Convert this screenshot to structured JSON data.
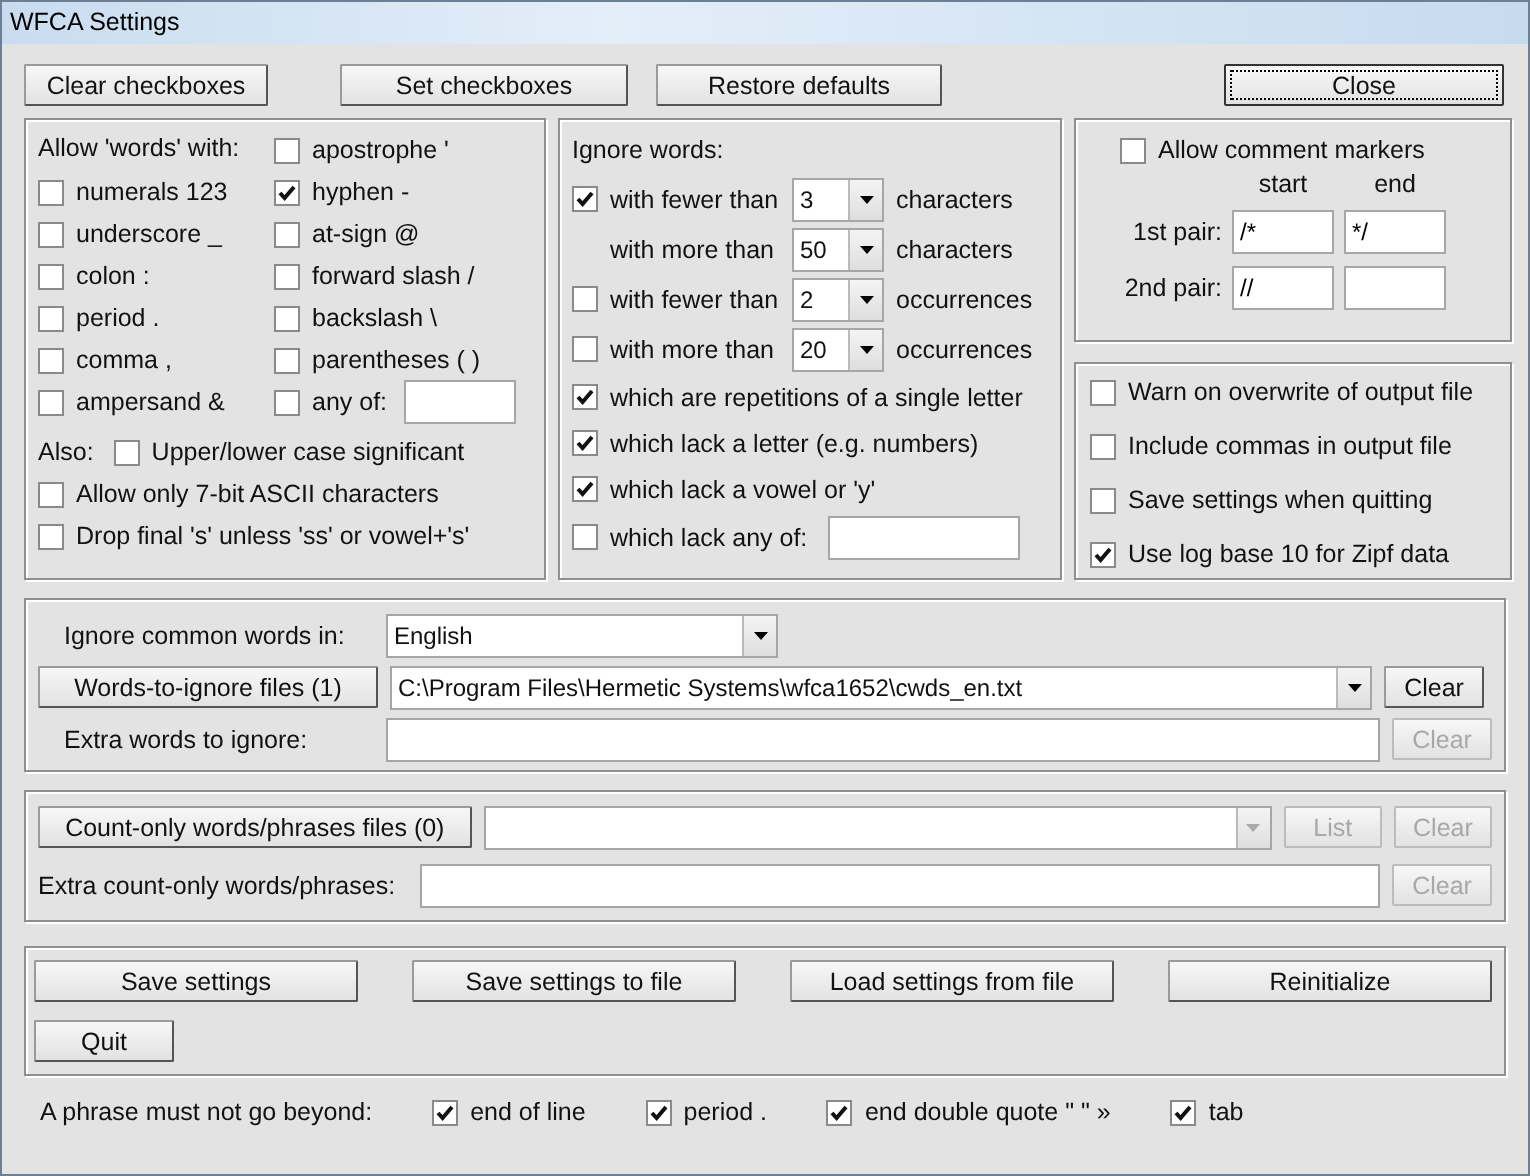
{
  "window": {
    "title": "WFCA Settings"
  },
  "top_buttons": [
    {
      "label": "Clear checkboxes",
      "focused": false
    },
    {
      "label": "Set checkboxes",
      "focused": false
    },
    {
      "label": "Restore defaults",
      "focused": false
    },
    {
      "label": "Close",
      "focused": true
    }
  ],
  "allow_words": {
    "heading": "Allow 'words' with:",
    "left": [
      {
        "label": "numerals 123",
        "checked": false
      },
      {
        "label": "underscore _",
        "checked": false
      },
      {
        "label": "colon :",
        "checked": false
      },
      {
        "label": "period .",
        "checked": false
      },
      {
        "label": "comma ,",
        "checked": false
      },
      {
        "label": "ampersand &",
        "checked": false
      }
    ],
    "right": [
      {
        "kind": "check",
        "label": "apostrophe '",
        "checked": false
      },
      {
        "kind": "check",
        "label": "hyphen -",
        "checked": true
      },
      {
        "kind": "check",
        "label": "at-sign @",
        "checked": false
      },
      {
        "kind": "check",
        "label": "forward slash /",
        "checked": false
      },
      {
        "kind": "check",
        "label": "backslash \\",
        "checked": false
      },
      {
        "kind": "check",
        "label": "parentheses ( )",
        "checked": false
      },
      {
        "kind": "field",
        "label": "any of:",
        "checked": false
      }
    ],
    "also_label": "Also:",
    "also": {
      "label": "Upper/lower case significant",
      "checked": false
    },
    "more": [
      {
        "label": "Allow only 7-bit ASCII characters",
        "checked": false
      },
      {
        "label": "Drop final 's' unless 'ss' or vowel+'s'",
        "checked": false
      }
    ]
  },
  "ignore_words": {
    "heading": "Ignore words:",
    "rows": [
      {
        "kind": "threshold",
        "checked": true,
        "label": "with fewer than",
        "value": "3",
        "unit": "characters"
      },
      {
        "kind": "threshold_plain",
        "label": "with more than",
        "value": "50",
        "unit": "characters"
      },
      {
        "kind": "threshold",
        "checked": false,
        "label": "with fewer than",
        "value": "2",
        "unit": "occurrences"
      },
      {
        "kind": "threshold",
        "checked": false,
        "label": "with more than",
        "value": "20",
        "unit": "occurrences"
      },
      {
        "kind": "check",
        "checked": true,
        "label": "which are repetitions of a single letter"
      },
      {
        "kind": "check",
        "checked": true,
        "label": "which lack a letter (e.g. numbers)"
      },
      {
        "kind": "check",
        "checked": true,
        "label": "which lack a vowel or 'y'"
      },
      {
        "kind": "field",
        "checked": false,
        "label": "which lack any of:"
      }
    ]
  },
  "comment_markers": {
    "label": "Allow comment markers",
    "checked": false,
    "start_heading": "start",
    "end_heading": "end",
    "pairs": [
      {
        "label": "1st pair:",
        "start": "/*",
        "end": "*/"
      },
      {
        "label": "2nd pair:",
        "start": "//"
      }
    ]
  },
  "output_options": [
    {
      "label": "Warn on overwrite of output file",
      "checked": false
    },
    {
      "label": "Include commas in output file",
      "checked": false
    },
    {
      "label": "Save settings when quitting",
      "checked": false
    },
    {
      "label": "Use log base 10 for Zipf data",
      "checked": true
    }
  ],
  "common_words": {
    "label": "Ignore common words in:",
    "language": "English",
    "files_button": "Words-to-ignore files (1)",
    "file_path": "C:\\Program Files\\Hermetic Systems\\wfca1652\\cwds_en.txt",
    "clear_button": {
      "label": "Clear",
      "disabled": false
    },
    "extra_label": "Extra words to ignore:",
    "extra_clear": {
      "label": "Clear",
      "disabled": true
    }
  },
  "count_only": {
    "files_button": "Count-only words/phrases files (0)",
    "file_list_disabled": true,
    "list_button": {
      "label": "List",
      "disabled": true
    },
    "clear_button": {
      "label": "Clear",
      "disabled": true
    },
    "extra_label": "Extra count-only words/phrases:",
    "extra_clear": {
      "label": "Clear",
      "disabled": true
    }
  },
  "action_buttons": [
    {
      "label": "Save settings"
    },
    {
      "label": "Save settings to file"
    },
    {
      "label": "Load settings from file"
    },
    {
      "label": "Reinitialize"
    },
    {
      "label": "Quit"
    }
  ],
  "phrase_limit": {
    "label": "A phrase must not go beyond:",
    "options": [
      {
        "label": "end of line",
        "checked": true
      },
      {
        "label": "period .",
        "checked": true
      },
      {
        "label": "end double quote \" \" »",
        "checked": true
      },
      {
        "label": "tab",
        "checked": true
      }
    ]
  }
}
